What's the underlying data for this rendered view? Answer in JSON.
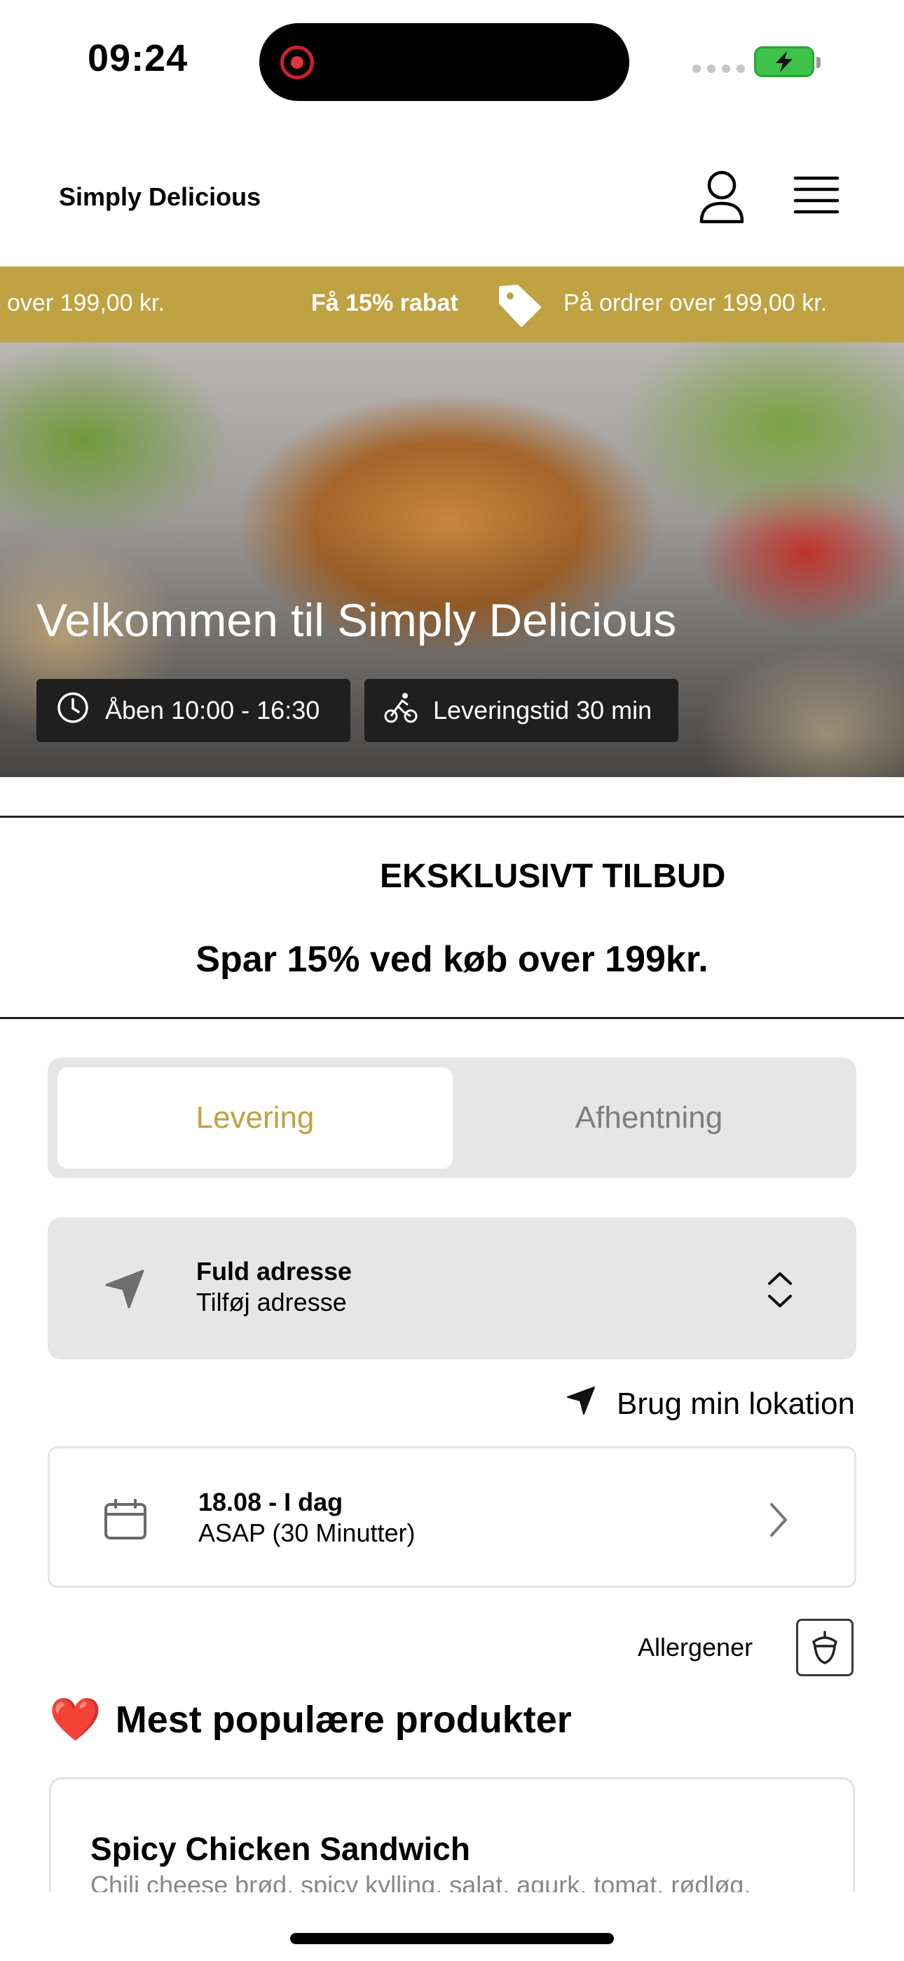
{
  "status_bar": {
    "time": "09:24"
  },
  "header": {
    "brand": "Simply Delicious",
    "icons": {
      "user": "user-icon",
      "menu": "menu-icon"
    }
  },
  "promo_banner": {
    "left_fragment": "over 199,00 kr.",
    "headline": "Få 15% rabat",
    "detail": "På ordrer over 199,00 kr.",
    "color": "#bfa241",
    "icon": "tag-icon"
  },
  "hero": {
    "title": "Velkommen til Simply Delicious",
    "opening_hours": "Åben 10:00 - 16:30",
    "delivery_time": "Leveringstid 30 min",
    "icons": {
      "hours": "clock-icon",
      "delivery": "bicycle-icon"
    }
  },
  "offer": {
    "title": "EKSKLUSIVT TILBUD",
    "subtitle": "Spar 15% ved køb over 199kr."
  },
  "order_type": {
    "tabs": [
      {
        "label": "Levering",
        "active": true
      },
      {
        "label": "Afhentning",
        "active": false
      }
    ],
    "active_color": "#bfa241"
  },
  "address": {
    "label": "Fuld adresse",
    "value": "Tilføj adresse",
    "icon": "location-arrow-icon",
    "use_location_label": "Brug min lokation"
  },
  "schedule": {
    "date": "18.08 - I dag",
    "time": "ASAP (30 Minutter)",
    "icon": "calendar-icon"
  },
  "allergens": {
    "label": "Allergener",
    "icon": "acorn-icon"
  },
  "popular": {
    "heading": "Mest populære produkter",
    "heading_emoji": "❤️"
  },
  "products": [
    {
      "name": "Spicy Chicken Sandwich",
      "description": "Chili cheese brød, spicy kylling, salat, agurk, tomat, rødløg,"
    }
  ]
}
